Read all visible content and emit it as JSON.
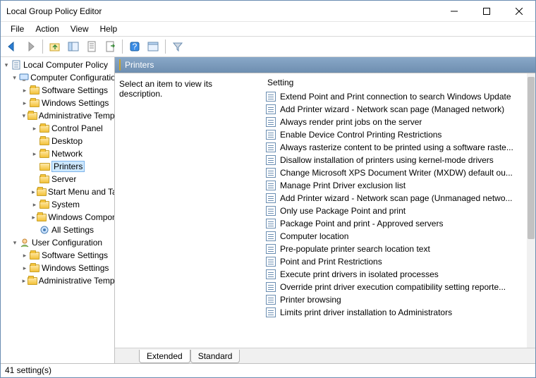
{
  "title": "Local Group Policy Editor",
  "menu": {
    "file": "File",
    "action": "Action",
    "view": "View",
    "help": "Help"
  },
  "tree": {
    "root": "Local Computer Policy",
    "cc": "Computer Configuration",
    "cc_children": [
      "Software Settings",
      "Windows Settings",
      "Administrative Templates"
    ],
    "at_children": [
      "Control Panel",
      "Desktop",
      "Network",
      "Printers",
      "Server",
      "Start Menu and Taskbar",
      "System",
      "Windows Components",
      "All Settings"
    ],
    "uc": "User Configuration",
    "uc_children": [
      "Software Settings",
      "Windows Settings",
      "Administrative Templates"
    ]
  },
  "right": {
    "header": "Printers",
    "description": "Select an item to view its description.",
    "column": "Setting",
    "items": [
      "Extend Point and Print connection to search Windows Update",
      "Add Printer wizard - Network scan page (Managed network)",
      "Always render print jobs on the server",
      "Enable Device Control Printing Restrictions",
      "Always rasterize content to be printed using a software raste...",
      "Disallow installation of printers using kernel-mode drivers",
      "Change Microsoft XPS Document Writer (MXDW) default ou...",
      "Manage Print Driver exclusion list",
      "Add Printer wizard - Network scan page (Unmanaged netwo...",
      "Only use Package Point and print",
      "Package Point and print - Approved servers",
      "Computer location",
      "Pre-populate printer search location text",
      "Point and Print Restrictions",
      "Execute print drivers in isolated processes",
      "Override print driver execution compatibility setting reporte...",
      "Printer browsing",
      "Limits print driver installation to Administrators"
    ],
    "tabs": {
      "extended": "Extended",
      "standard": "Standard"
    }
  },
  "status": "41 setting(s)"
}
